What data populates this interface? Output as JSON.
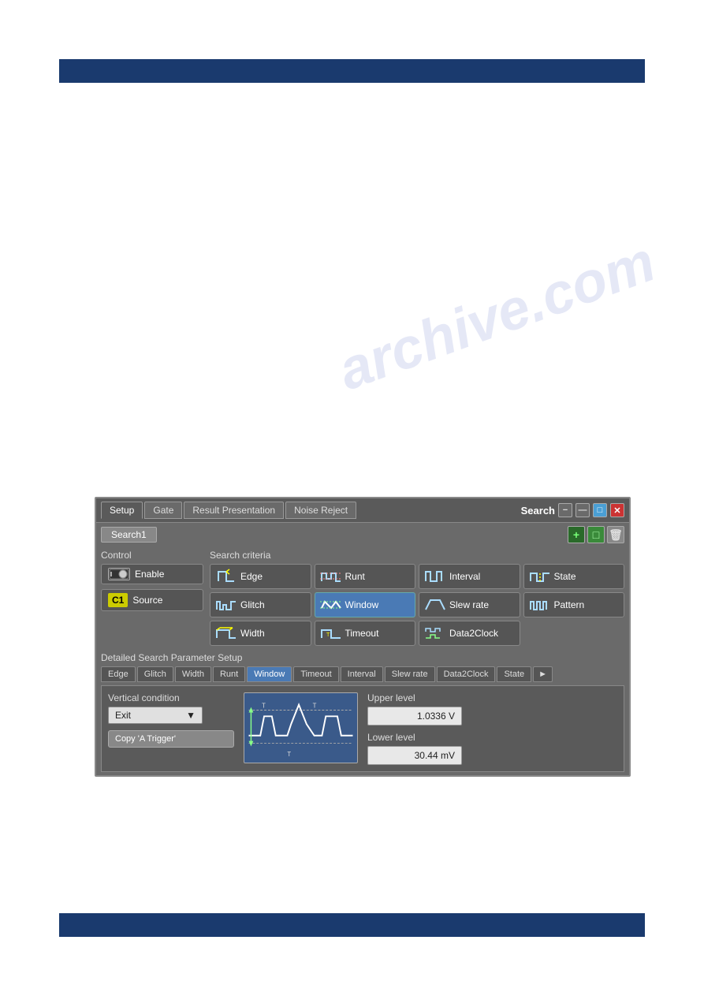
{
  "page": {
    "watermark": "archive.com"
  },
  "dialog": {
    "title": "Search",
    "tabs": [
      {
        "id": "setup",
        "label": "Setup",
        "active": true
      },
      {
        "id": "gate",
        "label": "Gate",
        "active": false
      },
      {
        "id": "result-presentation",
        "label": "Result Presentation",
        "active": false
      },
      {
        "id": "noise-reject",
        "label": "Noise Reject",
        "active": false
      }
    ],
    "win_buttons": {
      "minus_small": "−",
      "minus": "—",
      "resize": "□",
      "close": "✕"
    },
    "search_name": "Search1",
    "add_btn": "+",
    "green_btn": "□",
    "del_btn": "🗑",
    "control_label": "Control",
    "enable_label": "Enable",
    "source_label": "Source",
    "source_badge": "C1",
    "criteria_label": "Search criteria",
    "criteria_items": [
      {
        "id": "edge",
        "label": "Edge",
        "active": false
      },
      {
        "id": "runt",
        "label": "Runt",
        "active": false
      },
      {
        "id": "interval",
        "label": "Interval",
        "active": false
      },
      {
        "id": "state",
        "label": "State",
        "active": false
      },
      {
        "id": "glitch",
        "label": "Glitch",
        "active": false
      },
      {
        "id": "window",
        "label": "Window",
        "active": true
      },
      {
        "id": "slew-rate",
        "label": "Slew rate",
        "active": false
      },
      {
        "id": "pattern",
        "label": "Pattern",
        "active": false
      },
      {
        "id": "width",
        "label": "Width",
        "active": false
      },
      {
        "id": "timeout",
        "label": "Timeout",
        "active": false
      },
      {
        "id": "data2clock",
        "label": "Data2Clock",
        "active": false
      }
    ],
    "detailed_label": "Detailed Search Parameter Setup",
    "param_tabs": [
      {
        "id": "edge-tab",
        "label": "Edge",
        "active": false
      },
      {
        "id": "glitch-tab",
        "label": "Glitch",
        "active": false
      },
      {
        "id": "width-tab",
        "label": "Width",
        "active": false
      },
      {
        "id": "runt-tab",
        "label": "Runt",
        "active": false
      },
      {
        "id": "window-tab",
        "label": "Window",
        "active": true
      },
      {
        "id": "timeout-tab",
        "label": "Timeout",
        "active": false
      },
      {
        "id": "interval-tab",
        "label": "Interval",
        "active": false
      },
      {
        "id": "slewrate-tab",
        "label": "Slew rate",
        "active": false
      },
      {
        "id": "data2clock-tab",
        "label": "Data2Clock",
        "active": false
      },
      {
        "id": "state-tab",
        "label": "State",
        "active": false
      }
    ],
    "more_btn": "►",
    "vertical_condition_label": "Vertical condition",
    "vertical_condition_value": "Exit",
    "copy_trigger_label": "Copy 'A Trigger'",
    "upper_level_label": "Upper level",
    "upper_level_value": "1.0336 V",
    "lower_level_label": "Lower level",
    "lower_level_value": "30.44 mV"
  }
}
